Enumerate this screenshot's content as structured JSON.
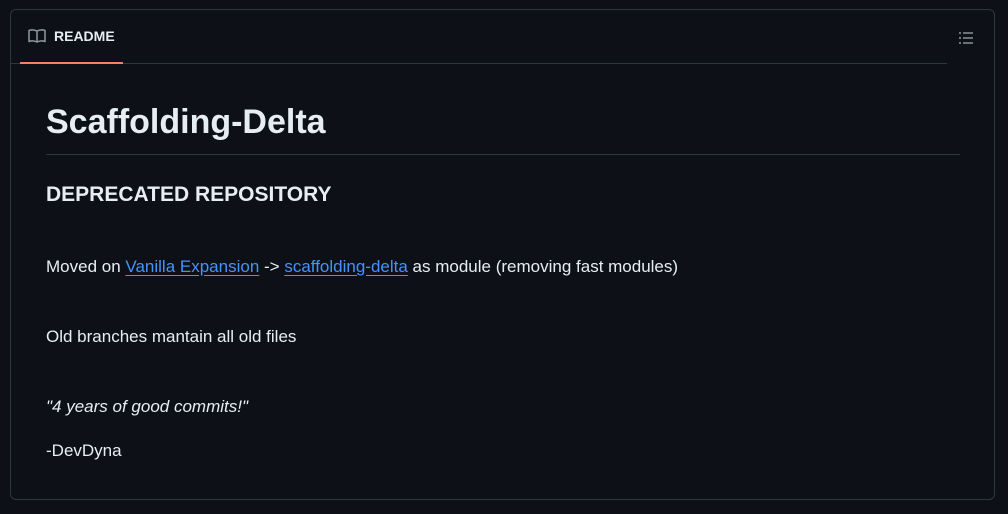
{
  "readme": {
    "tab_label": "README",
    "title": "Scaffolding-Delta",
    "subheading": "DEPRECATED REPOSITORY",
    "moved_prefix": "Moved on ",
    "link_vanilla": "Vanilla Expansion",
    "arrow": " -> ",
    "link_scaffolding": "scaffolding-delta",
    "moved_suffix": " as module (removing fast modules)",
    "old_branches": "Old branches mantain all old files",
    "quote": "\"4 years of good commits!\"",
    "signature": "-DevDyna"
  },
  "icons": {
    "tab_icon": "book-icon",
    "toc_icon": "list-unordered-icon"
  },
  "colors": {
    "background": "#0d1117",
    "border": "#30363d",
    "text": "#e6edf3",
    "link": "#4493f8",
    "tab_underline": "#f78166"
  }
}
